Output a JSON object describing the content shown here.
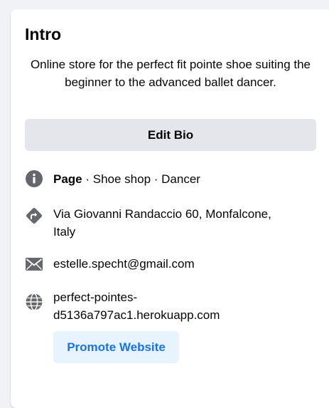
{
  "intro": {
    "title": "Intro",
    "bio": "Online store for the perfect fit pointe shoe suiting the beginner to the advanced ballet dancer.",
    "edit_bio_label": "Edit Bio"
  },
  "details": {
    "page_label": "Page",
    "page_categories": " · Shoe shop · Dancer",
    "address_line1": "Via Giovanni Randaccio 60, Monfalcone,",
    "address_line2": "Italy",
    "email": "estelle.specht@gmail.com",
    "website_line1": "perfect-pointes-",
    "website_line2": "d5136a797ac1.herokuapp.com",
    "promote_label": "Promote Website"
  },
  "icons": {
    "info": "info-icon",
    "directions": "directions-icon",
    "email": "envelope-icon",
    "website": "globe-icon"
  },
  "colors": {
    "icon_gray": "#65676b",
    "link_blue": "#216fdb",
    "promote_bg": "#e7f3ff",
    "promote_text": "#1b74e4",
    "button_gray": "#e4e6eb"
  }
}
